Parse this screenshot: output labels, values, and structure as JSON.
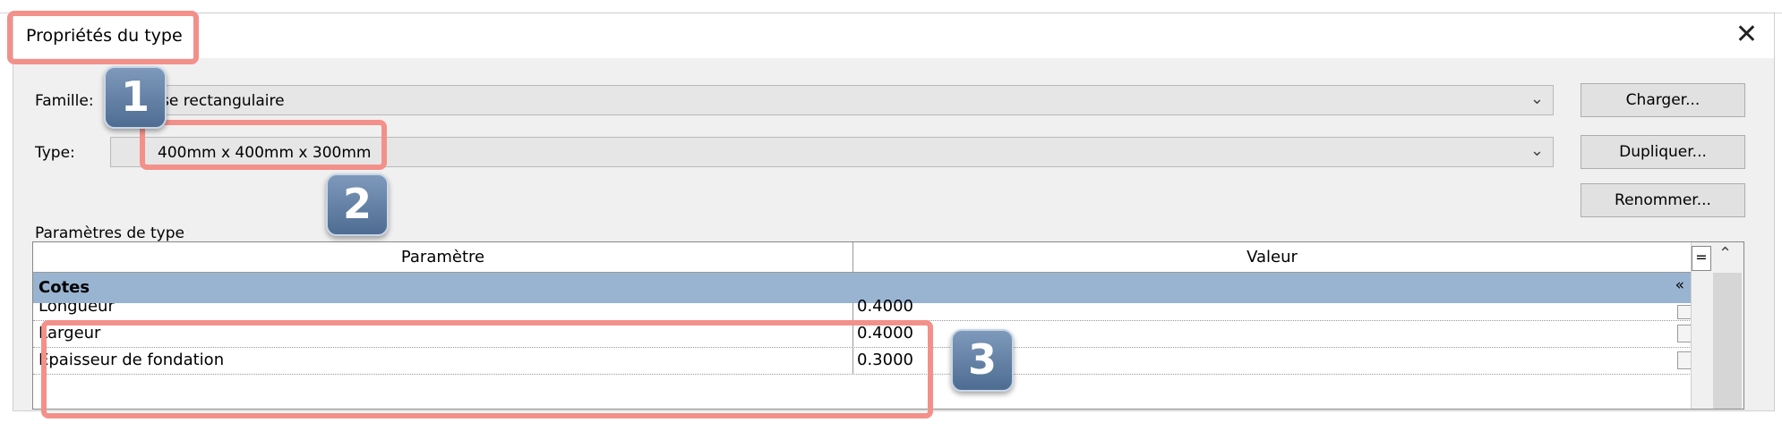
{
  "dialog": {
    "title": "Propriétés du type",
    "close_glyph": "✕"
  },
  "family": {
    "label": "Famille:",
    "value": "Base rectangulaire"
  },
  "type": {
    "label": "Type:",
    "value": "400mm x 400mm x 300mm"
  },
  "buttons": {
    "load": "Charger...",
    "duplicate": "Dupliquer...",
    "rename": "Renommer..."
  },
  "params": {
    "section_label": "Paramètres de type",
    "columns": [
      "Paramètre",
      "Valeur"
    ],
    "equals_glyph": "=",
    "group": {
      "name": "Cotes",
      "collapse_glyph": "«"
    },
    "rows": [
      {
        "name": "Longueur",
        "value": "0.4000"
      },
      {
        "name": "Largeur",
        "value": "0.4000"
      },
      {
        "name": "Épaisseur de fondation",
        "value": "0.3000"
      }
    ]
  },
  "annotations": {
    "badges": [
      "1",
      "2",
      "3"
    ]
  },
  "colors": {
    "highlight": "#f3908a",
    "group_header": "#99b4d1",
    "badge": "#5f7fa5"
  }
}
